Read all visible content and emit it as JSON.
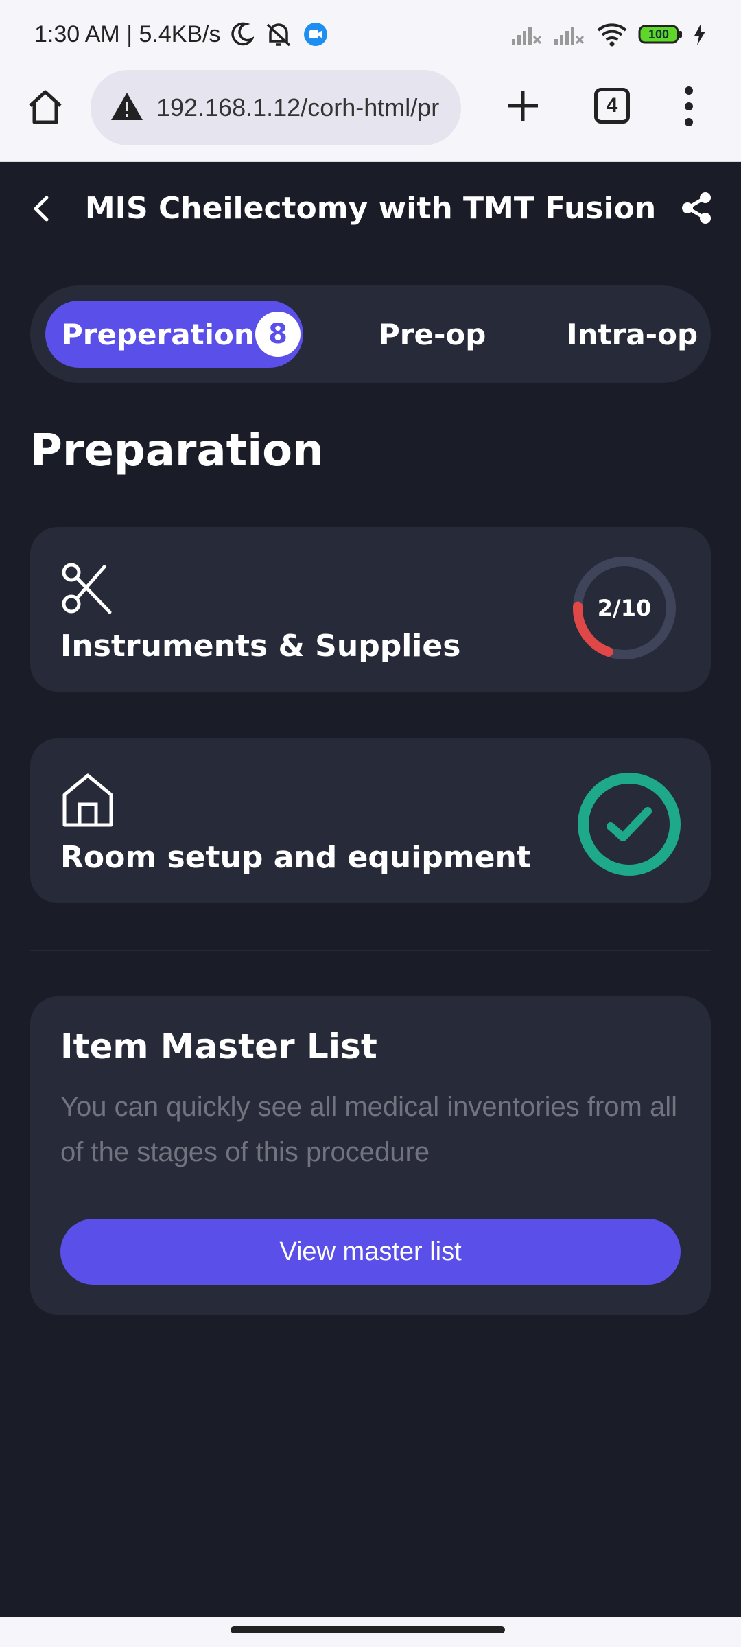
{
  "status_bar": {
    "time_text": "1:30 AM | 5.4KB/s",
    "battery_level": "100",
    "icons": [
      "moon-icon",
      "notifications-off-icon",
      "video-call-icon",
      "signal-x-icon",
      "signal-x-icon",
      "wifi-icon",
      "battery-icon",
      "charging-icon"
    ]
  },
  "browser": {
    "url": "192.168.1.12/corh-html/pr",
    "tab_count": "4",
    "icons": [
      "home-icon",
      "warning-icon",
      "plus-icon",
      "more-vert-icon"
    ]
  },
  "header": {
    "title": "MIS Cheilectomy with TMT Fusion"
  },
  "tabs": {
    "items": [
      {
        "label": "Preperation",
        "badge": "8",
        "active": true
      },
      {
        "label": "Pre-op",
        "active": false
      },
      {
        "label": "Intra-op",
        "active": false
      }
    ]
  },
  "section": {
    "title": "Preparation"
  },
  "cards": [
    {
      "label": "Instruments & Supplies",
      "icon": "scissors-icon",
      "progress_text": "2/10",
      "progress": 0.2
    },
    {
      "label": "Room setup and equipment",
      "icon": "house-icon",
      "status": "complete"
    }
  ],
  "master_list": {
    "title": "Item Master List",
    "description": "You can quickly see all medical inventories from all of the stages of this procedure",
    "button_label": "View master list"
  },
  "colors": {
    "background": "#1a1c27",
    "card": "#272a38",
    "accent": "#5a4fe8",
    "progress": "#e04848",
    "complete": "#1da98a"
  }
}
